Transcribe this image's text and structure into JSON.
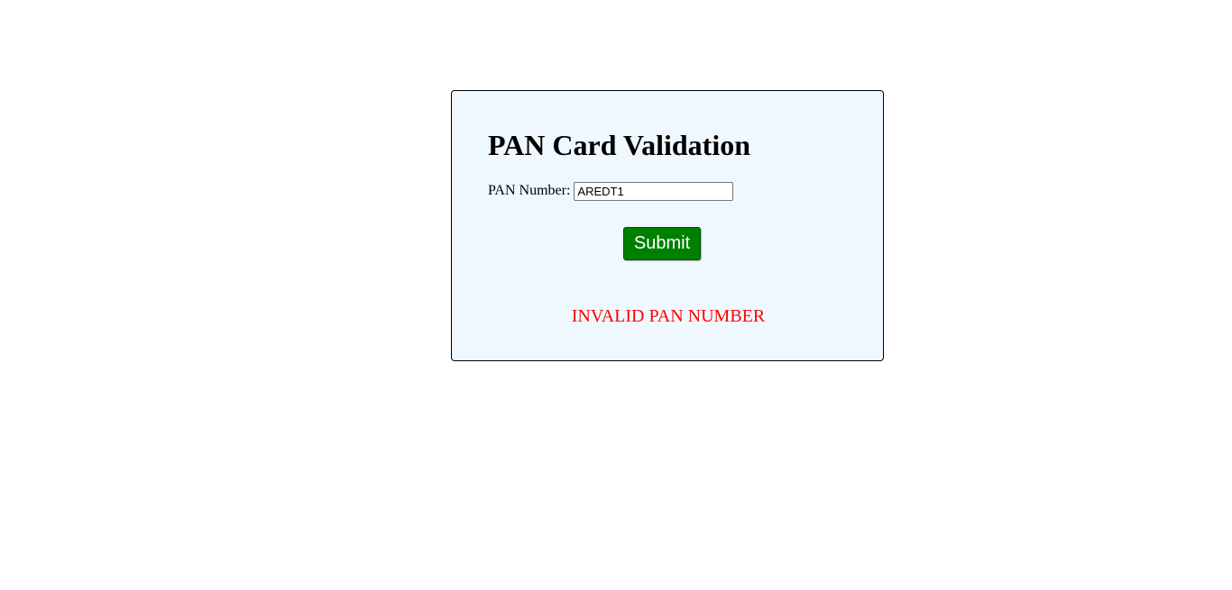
{
  "form": {
    "title": "PAN Card Validation",
    "pan_label": "PAN Number:",
    "pan_value": "AREDT1",
    "submit_label": "Submit",
    "result_message": "INVALID PAN NUMBER"
  },
  "colors": {
    "card_background": "#f0f8ff",
    "submit_button": "#008000",
    "error_text": "#ff0000"
  }
}
